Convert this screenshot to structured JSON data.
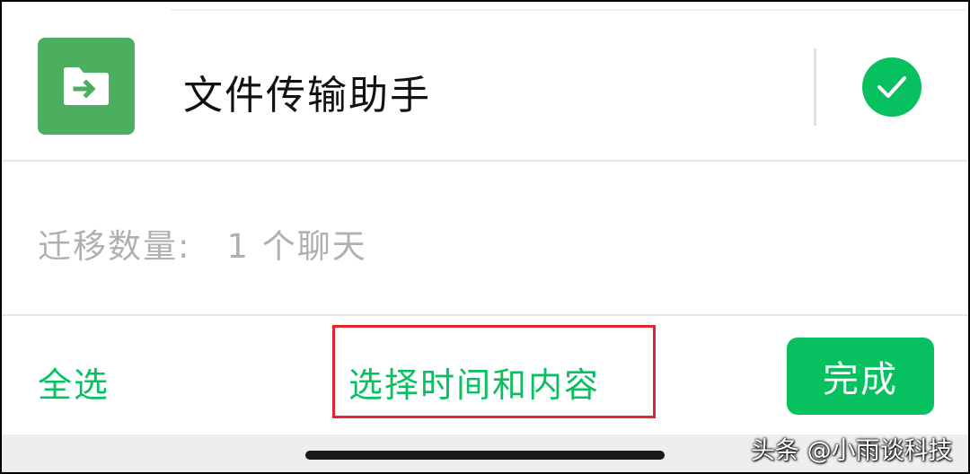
{
  "contact": {
    "name": "文件传输助手",
    "icon": "folder-arrow-icon",
    "selected": true
  },
  "migrate": {
    "label": "迁移数量:",
    "count": "1 个聊天"
  },
  "bottom_bar": {
    "select_all": "全选",
    "select_time_content": "选择时间和内容",
    "done": "完成"
  },
  "watermark": "头条 @小雨谈科技",
  "colors": {
    "accent": "#07c160",
    "icon_bg": "#4caf60",
    "highlight": "#e0262f"
  }
}
